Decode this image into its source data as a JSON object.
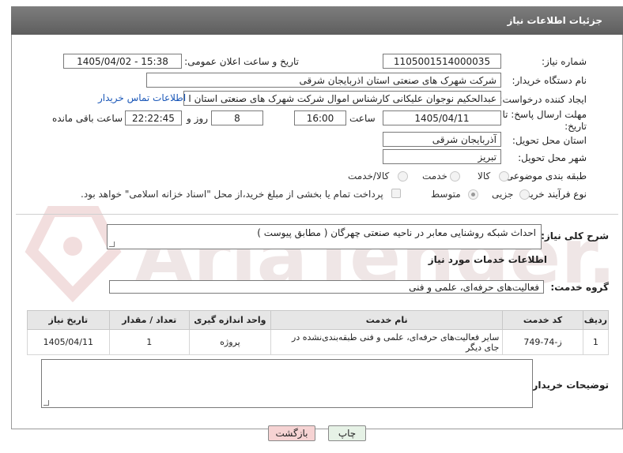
{
  "header": {
    "title": "جزئیات اطلاعات نیاز"
  },
  "fields": {
    "need_number_label": "شماره نیاز:",
    "need_number": "1105001514000035",
    "announce_label": "تاریخ و ساعت اعلان عمومی:",
    "announce_value": "1405/04/02 - 15:38",
    "buyer_label": "نام دستگاه خریدار:",
    "buyer_value": "شرکت شهرک های صنعتی استان اذربایجان شرقی",
    "creator_label": "ایجاد کننده درخواست:",
    "creator_value": "عبدالحکیم نوجوان علیکانی کارشناس اموال شرکت شهرک های صنعتی استان ا",
    "contact_link": "اطلاعات تماس خریدار",
    "deadline_label_1": "مهلت ارسال پاسخ: تا",
    "deadline_label_2": "تاریخ:",
    "deadline_date": "1405/04/11",
    "time_label": "ساعت",
    "deadline_time": "16:00",
    "days_value": "8",
    "days_label": "روز و",
    "remaining_time": "22:22:45",
    "remaining_label": "ساعت باقی مانده",
    "province_label": "استان محل تحویل:",
    "province_value": "آذربایجان شرقی",
    "city_label": "شهر محل تحویل:",
    "city_value": "تبریز",
    "category_label": "طبقه بندی موضوعی:",
    "category_options": [
      "کالا",
      "خدمت",
      "کالا/خدمت"
    ],
    "process_label": "نوع فرآیند خرید :",
    "process_options": [
      "جزیی",
      "متوسط"
    ],
    "payment_note": "پرداخت تمام یا بخشی از مبلغ خرید،از محل \"اسناد خزانه اسلامی\" خواهد بود."
  },
  "description": {
    "label": "شرح کلی نیاز:",
    "value": "احداث شبکه روشنایی معابر در ناحیه صنعتی چهرگان ( مطابق پیوست )"
  },
  "services": {
    "section_title": "اطلاعات خدمات مورد نیاز",
    "group_label": "گروه خدمت:",
    "group_value": "فعالیت‌های حرفه‌ای، علمی و فنی",
    "columns": [
      "ردیف",
      "کد خدمت",
      "نام خدمت",
      "واحد اندازه گیری",
      "تعداد / مقدار",
      "تاریخ نیاز"
    ],
    "rows": [
      {
        "index": "1",
        "code": "ز-74-749",
        "name": "سایر فعالیت‌های حرفه‌ای، علمی و فنی طبقه‌بندی‌نشده در جای دیگر",
        "unit": "پروژه",
        "qty": "1",
        "date": "1405/04/11"
      }
    ]
  },
  "buyer_notes": {
    "label": "توضیحات خریدار:",
    "value": ""
  },
  "buttons": {
    "print": "چاپ",
    "back": "بازگشت"
  },
  "watermark": {
    "text": "AriaTender.net"
  },
  "colors": {
    "header": "#6b6b6b",
    "link": "#1a57b8",
    "back_button": "#f6d3d3",
    "print_button": "#e6f2e6"
  }
}
